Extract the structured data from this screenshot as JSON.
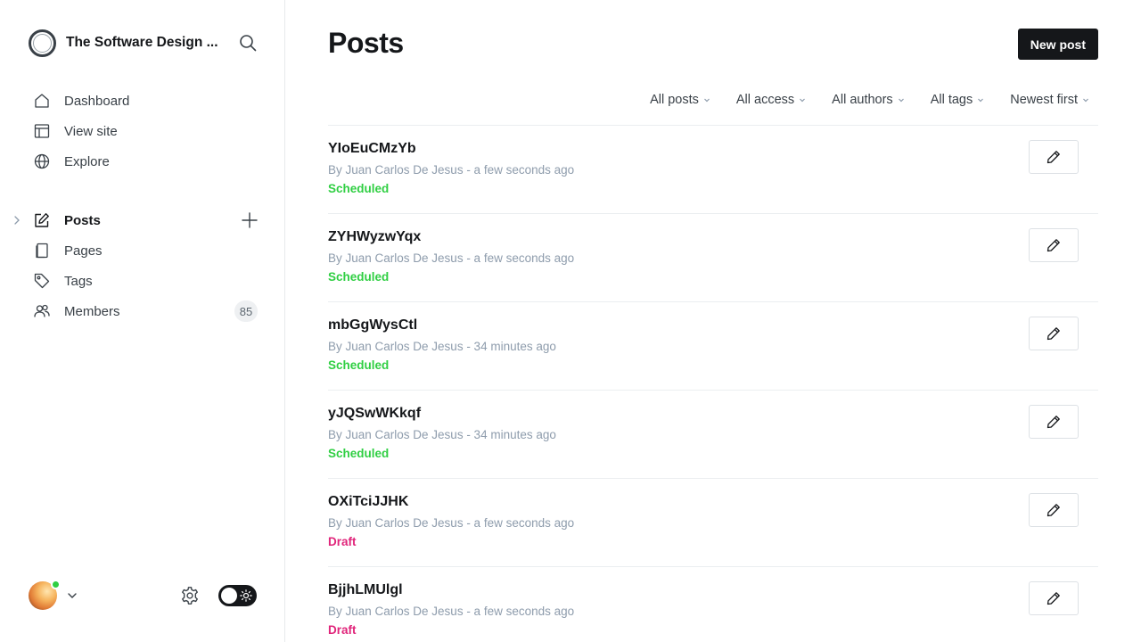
{
  "site": {
    "title": "The Software Design ..."
  },
  "nav_top": [
    {
      "label": "Dashboard",
      "icon": "home-icon"
    },
    {
      "label": "View site",
      "icon": "layout-icon"
    },
    {
      "label": "Explore",
      "icon": "globe-icon"
    }
  ],
  "nav_main": [
    {
      "label": "Posts",
      "icon": "pencil-square-icon",
      "active": true
    },
    {
      "label": "Pages",
      "icon": "pages-icon"
    },
    {
      "label": "Tags",
      "icon": "tag-icon"
    },
    {
      "label": "Members",
      "icon": "members-icon",
      "badge": "85"
    }
  ],
  "header": {
    "title": "Posts",
    "new_post_label": "New post"
  },
  "filters": [
    "All posts",
    "All access",
    "All authors",
    "All tags",
    "Newest first"
  ],
  "posts": [
    {
      "title": "YIoEuCMzYb",
      "meta": "By Juan Carlos De Jesus - a few seconds ago",
      "status": "Scheduled"
    },
    {
      "title": "ZYHWyzwYqx",
      "meta": "By Juan Carlos De Jesus - a few seconds ago",
      "status": "Scheduled"
    },
    {
      "title": "mbGgWysCtl",
      "meta": "By Juan Carlos De Jesus - 34 minutes ago",
      "status": "Scheduled"
    },
    {
      "title": "yJQSwWKkqf",
      "meta": "By Juan Carlos De Jesus - 34 minutes ago",
      "status": "Scheduled"
    },
    {
      "title": "OXiTciJJHK",
      "meta": "By Juan Carlos De Jesus - a few seconds ago",
      "status": "Draft"
    },
    {
      "title": "BjjhLMUlgl",
      "meta": "By Juan Carlos De Jesus - a few seconds ago",
      "status": "Draft"
    }
  ],
  "colors": {
    "accent": "#15171a",
    "scheduled": "#30cf43",
    "draft": "#e0247a",
    "online": "#30cf43"
  }
}
